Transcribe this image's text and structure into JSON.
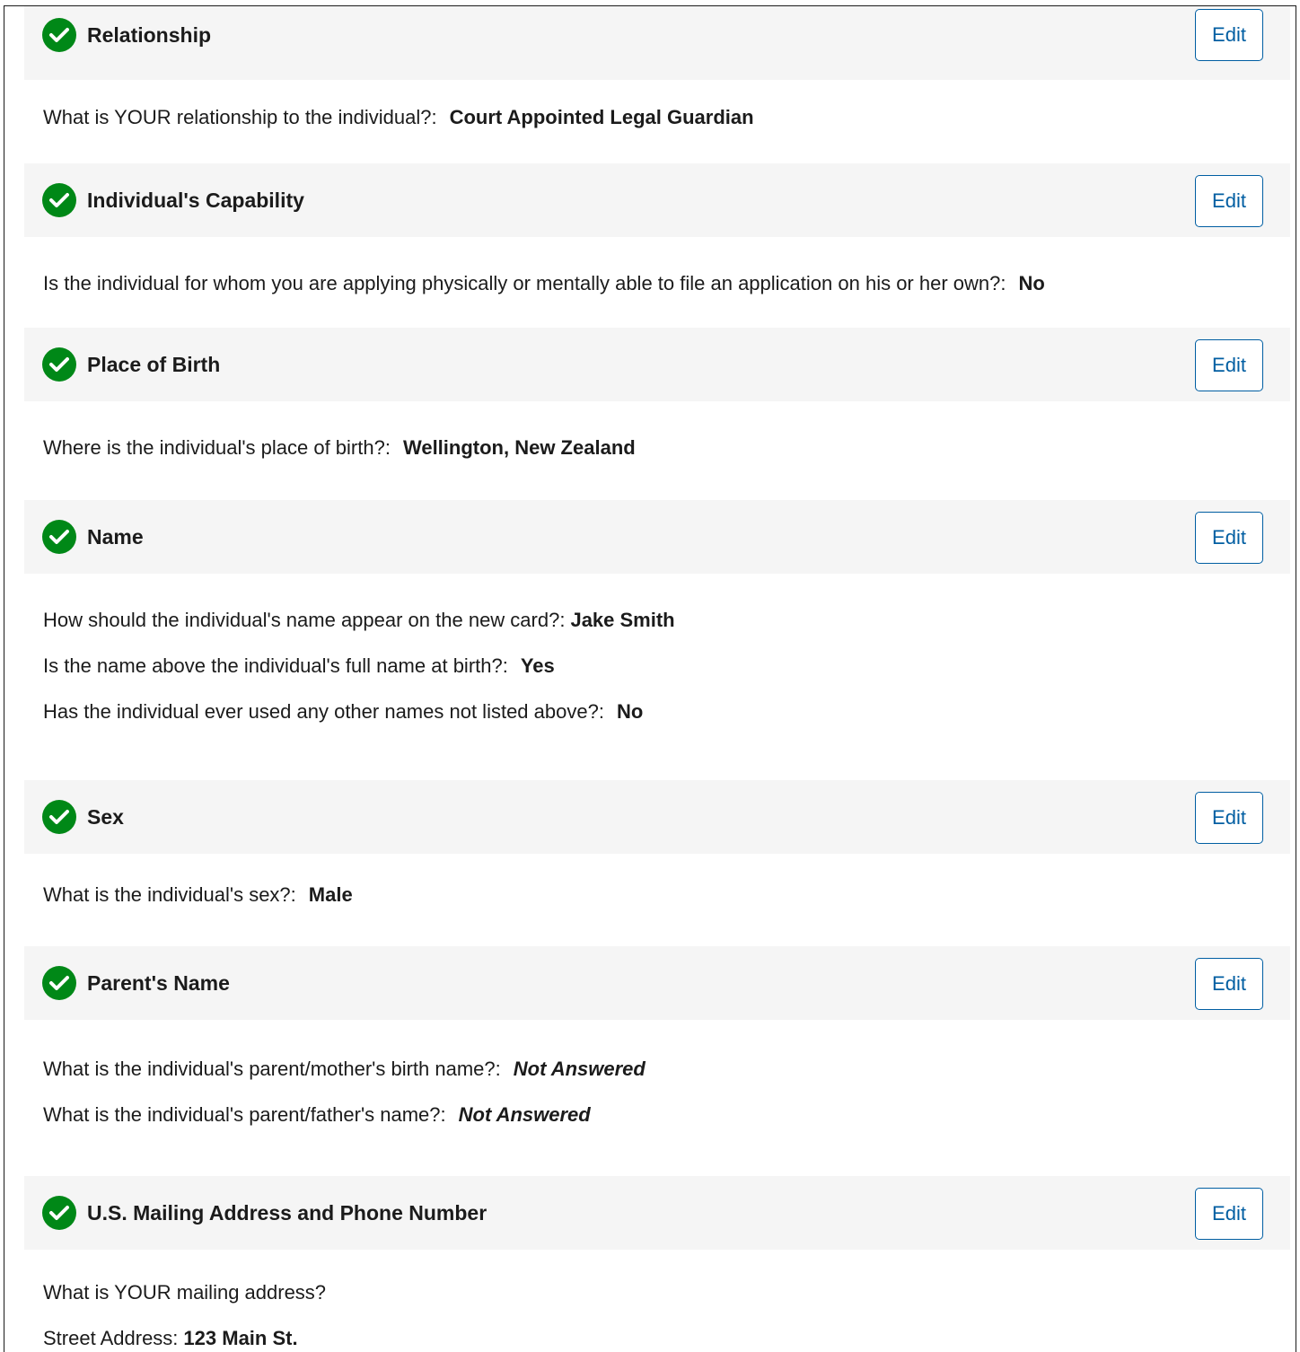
{
  "edit_label": "Edit",
  "colors": {
    "check": "#008817",
    "edit_accent": "#005ea2",
    "header_bg": "#f5f5f5"
  },
  "sections": [
    {
      "title": "Relationship",
      "icon": "check-circle-icon",
      "items": [
        {
          "q": "What is YOUR relationship to the individual?:",
          "a": "Court Appointed Legal Guardian"
        }
      ]
    },
    {
      "title": "Individual's Capability",
      "icon": "check-circle-icon",
      "items": [
        {
          "q": "Is the individual for whom you are applying physically or mentally able to file an application on his or her own?:",
          "a": "No"
        }
      ]
    },
    {
      "title": "Place of Birth",
      "icon": "check-circle-icon",
      "items": [
        {
          "q": "Where is the individual's place of birth?:",
          "a": "Wellington, New Zealand"
        }
      ]
    },
    {
      "title": "Name",
      "icon": "check-circle-icon",
      "items": [
        {
          "q": "How should the individual's name appear on the new card?:",
          "a": "Jake Smith"
        },
        {
          "q": "Is the name above the individual's full name at birth?:",
          "a": "Yes"
        },
        {
          "q": "Has the individual ever used any other names not listed above?:",
          "a": "No"
        }
      ]
    },
    {
      "title": "Sex",
      "icon": "check-circle-icon",
      "items": [
        {
          "q": "What is the individual's sex?:",
          "a": "Male"
        }
      ]
    },
    {
      "title": "Parent's Name",
      "icon": "check-circle-icon",
      "items": [
        {
          "q": "What is the individual's parent/mother's birth name?:",
          "a": "Not Answered"
        },
        {
          "q": "What is the individual's parent/father's name?:",
          "a": "Not Answered"
        }
      ]
    },
    {
      "title": "U.S. Mailing Address and Phone Number",
      "icon": "check-circle-icon",
      "items": [
        {
          "q": "What is YOUR mailing address?",
          "a": ""
        },
        {
          "q": "Street Address:",
          "a": "123 Main St."
        }
      ]
    }
  ]
}
